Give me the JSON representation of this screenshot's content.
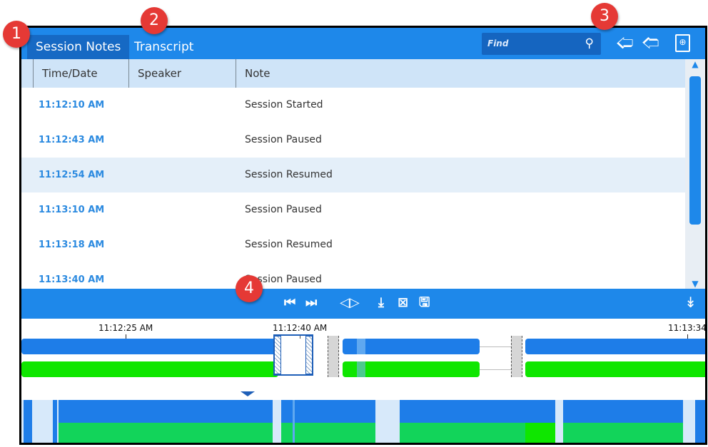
{
  "tabs": [
    {
      "label": "Session Notes",
      "active": true
    },
    {
      "label": "Transcript",
      "active": false
    }
  ],
  "search": {
    "placeholder": "Find"
  },
  "toolbar_icons": [
    "search-icon",
    "arrow-left-icon",
    "arrow-right-icon",
    "zoom-document-icon"
  ],
  "table": {
    "columns": [
      "Time/Date",
      "Speaker",
      "Note"
    ],
    "rows": [
      {
        "time": "11:12:10 AM",
        "speaker": "",
        "note": "Session Started"
      },
      {
        "time": "11:12:43 AM",
        "speaker": "",
        "note": "Session Paused"
      },
      {
        "time": "11:12:54 AM",
        "speaker": "",
        "note": "Session Resumed"
      },
      {
        "time": "11:13:10 AM",
        "speaker": "",
        "note": "Session Paused"
      },
      {
        "time": "11:13:18 AM",
        "speaker": "",
        "note": "Session Resumed"
      },
      {
        "time": "11:13:40 AM",
        "speaker": "",
        "note": "Session Paused"
      }
    ]
  },
  "transport_icons": [
    "skip-to-start-icon",
    "skip-to-end-icon",
    "trim-selection-icon",
    "export-icon",
    "delete-selection-icon",
    "save-icon",
    "collapse-panel-icon"
  ],
  "timeline": {
    "ticks": [
      "11:12:25 AM",
      "11:12:40 AM",
      "11:13:34"
    ]
  },
  "annotations": [
    "1",
    "2",
    "3",
    "4"
  ],
  "colors": {
    "accent": "#1e88ea",
    "active_tab": "#1669c4",
    "time_text": "#2b8ae0",
    "track_blue": "#1e7de8",
    "track_green": "#0fe600",
    "badge": "#e53935"
  }
}
